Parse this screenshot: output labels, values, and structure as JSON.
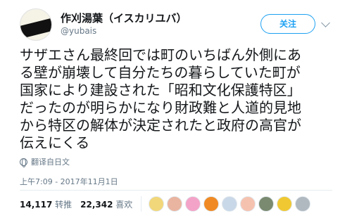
{
  "user": {
    "display_name": "作刈湯葉（イスカリユバ）",
    "handle": "@yubais"
  },
  "follow_label": "关注",
  "tweet": {
    "lines": [
      "サザエさん最終回では町のいちばん外側にあ",
      "る壁が崩壊して自分たちの暮らしていた町が",
      "国家により建設された「昭和文化保護特区」",
      "だったのが明らかになり財政難と人道的見地",
      "から特区の解体が決定されたと政府の高官が",
      "伝えにくる"
    ]
  },
  "translate_label": "翻译自日文",
  "timestamp": "上午7:09 - 2017年11月1日",
  "stats": {
    "retweets_count": "14,117",
    "retweets_label": "转推",
    "likes_count": "22,342",
    "likes_label": "喜欢"
  },
  "likers": [
    {
      "name": "liker-avatar-1",
      "color": "#f2d77a"
    },
    {
      "name": "liker-avatar-2",
      "color": "#e9b4a0"
    },
    {
      "name": "liker-avatar-3",
      "color": "#f4a3c8"
    },
    {
      "name": "liker-avatar-4",
      "color": "#f08a24"
    },
    {
      "name": "liker-avatar-5",
      "color": "#c9d8e8"
    },
    {
      "name": "liker-avatar-6",
      "color": "#f6c2b0"
    },
    {
      "name": "liker-avatar-7",
      "color": "#7a8a70"
    },
    {
      "name": "liker-avatar-8",
      "color": "#f0c832"
    },
    {
      "name": "liker-avatar-9",
      "color": "#b0b8c0"
    }
  ]
}
